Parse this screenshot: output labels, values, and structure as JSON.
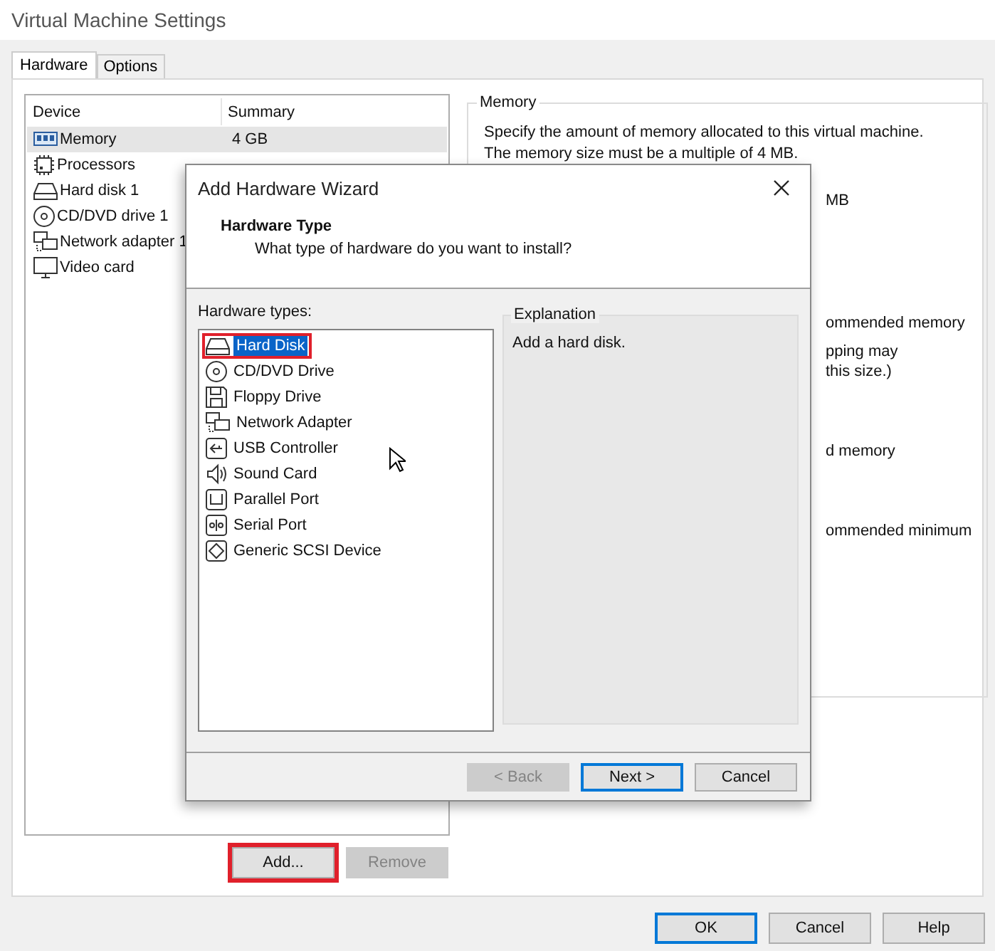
{
  "window": {
    "title": "Virtual Machine Settings"
  },
  "tabs": [
    {
      "label": "Hardware",
      "selected": true
    },
    {
      "label": "Options",
      "selected": false
    }
  ],
  "device_table": {
    "columns": [
      "Device",
      "Summary"
    ],
    "rows": [
      {
        "device": "Memory",
        "summary": "4 GB",
        "kind": "memory",
        "selected": true
      },
      {
        "device": "Processors",
        "kind": "processor",
        "selected": false
      },
      {
        "device": "Hard disk 1",
        "kind": "disk",
        "selected": false
      },
      {
        "device": "CD/DVD drive 1",
        "kind": "cd",
        "selected": false
      },
      {
        "device": "Network adapter 1",
        "kind": "network",
        "selected": false
      },
      {
        "device": "Video card",
        "kind": "display",
        "selected": false
      }
    ]
  },
  "device_buttons": [
    {
      "label": "Add...",
      "disabled": false,
      "highlighted": true
    },
    {
      "label": "Remove",
      "disabled": true,
      "highlighted": false
    }
  ],
  "memory_panel": {
    "title": "Memory",
    "description": [
      "Specify the amount of memory allocated to this virtual machine.",
      "The memory size must be a multiple of 4 MB."
    ],
    "unit": "MB",
    "fragments": [
      "ommended memory",
      "pping may",
      "this size.)",
      "d memory",
      "ommended minimum"
    ]
  },
  "footer_buttons": [
    {
      "label": "OK",
      "default": true
    },
    {
      "label": "Cancel",
      "default": false
    },
    {
      "label": "Help",
      "default": false
    }
  ],
  "dialog": {
    "title": "Add Hardware Wizard",
    "heading": "Hardware Type",
    "subheading": "What type of hardware do you want to install?",
    "list_label": "Hardware types:",
    "hardware_types": [
      {
        "label": "Hard Disk",
        "kind": "disk",
        "selected": true,
        "highlighted": true
      },
      {
        "label": "CD/DVD Drive",
        "kind": "cd",
        "selected": false,
        "highlighted": false
      },
      {
        "label": "Floppy Drive",
        "kind": "floppy",
        "selected": false,
        "highlighted": false
      },
      {
        "label": "Network Adapter",
        "kind": "network",
        "selected": false,
        "highlighted": false
      },
      {
        "label": "USB Controller",
        "kind": "usb",
        "selected": false,
        "highlighted": false
      },
      {
        "label": "Sound Card",
        "kind": "sound",
        "selected": false,
        "highlighted": false
      },
      {
        "label": "Parallel Port",
        "kind": "parallel",
        "selected": false,
        "highlighted": false
      },
      {
        "label": "Serial Port",
        "kind": "serial",
        "selected": false,
        "highlighted": false
      },
      {
        "label": "Generic SCSI Device",
        "kind": "scsi",
        "selected": false,
        "highlighted": false
      }
    ],
    "explanation_title": "Explanation",
    "explanation": "Add a hard disk.",
    "buttons": [
      {
        "label": "< Back",
        "disabled": true,
        "default": false
      },
      {
        "label": "Next >",
        "disabled": false,
        "default": true
      },
      {
        "label": "Cancel",
        "disabled": false,
        "default": false
      }
    ]
  }
}
